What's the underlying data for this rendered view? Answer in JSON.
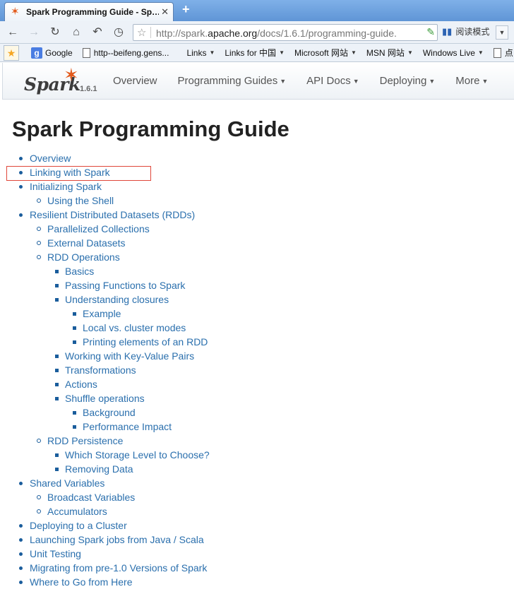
{
  "browser": {
    "tab_title": "Spark Programming Guide - Sp…",
    "tab_close": "✕",
    "new_tab": "+",
    "url_prefix": "http://spark.",
    "url_domain": "apache.org",
    "url_path": "/docs/1.6.1/programming-guide.",
    "reader_mode": "阅读模式",
    "bookmarks": [
      "Google",
      "http--beifeng.gens...",
      "Links",
      "Links for 中国",
      "Microsoft 网站",
      "MSN 网站",
      "Windows Live",
      "点"
    ]
  },
  "site": {
    "logo_text": "Spark",
    "version": "1.6.1",
    "menu": [
      "Overview",
      "Programming Guides",
      "API Docs",
      "Deploying",
      "More"
    ]
  },
  "page": {
    "title": "Spark Programming Guide",
    "toc": [
      {
        "label": "Overview",
        "level": 1
      },
      {
        "label": "Linking with Spark",
        "level": 1
      },
      {
        "label": "Initializing Spark",
        "level": 1
      },
      {
        "label": "Using the Shell",
        "level": 2
      },
      {
        "label": "Resilient Distributed Datasets (RDDs)",
        "level": 1
      },
      {
        "label": "Parallelized Collections",
        "level": 2
      },
      {
        "label": "External Datasets",
        "level": 2
      },
      {
        "label": "RDD Operations",
        "level": 2
      },
      {
        "label": "Basics",
        "level": 3
      },
      {
        "label": "Passing Functions to Spark",
        "level": 3
      },
      {
        "label": "Understanding closures",
        "level": 3
      },
      {
        "label": "Example",
        "level": 4
      },
      {
        "label": "Local vs. cluster modes",
        "level": 4
      },
      {
        "label": "Printing elements of an RDD",
        "level": 4
      },
      {
        "label": "Working with Key-Value Pairs",
        "level": 3
      },
      {
        "label": "Transformations",
        "level": 3
      },
      {
        "label": "Actions",
        "level": 3
      },
      {
        "label": "Shuffle operations",
        "level": 3
      },
      {
        "label": "Background",
        "level": 4
      },
      {
        "label": "Performance Impact",
        "level": 4
      },
      {
        "label": "RDD Persistence",
        "level": 2
      },
      {
        "label": "Which Storage Level to Choose?",
        "level": 3
      },
      {
        "label": "Removing Data",
        "level": 3
      },
      {
        "label": "Shared Variables",
        "level": 1
      },
      {
        "label": "Broadcast Variables",
        "level": 2
      },
      {
        "label": "Accumulators",
        "level": 2
      },
      {
        "label": "Deploying to a Cluster",
        "level": 1
      },
      {
        "label": "Launching Spark jobs from Java / Scala",
        "level": 1
      },
      {
        "label": "Unit Testing",
        "level": 1
      },
      {
        "label": "Migrating from pre-1.0 Versions of Spark",
        "level": 1
      },
      {
        "label": "Where to Go from Here",
        "level": 1
      }
    ]
  },
  "colors": {
    "link": "#2a6fad",
    "highlight_box": "#e0473a",
    "spark_orange": "#e25a1c"
  }
}
